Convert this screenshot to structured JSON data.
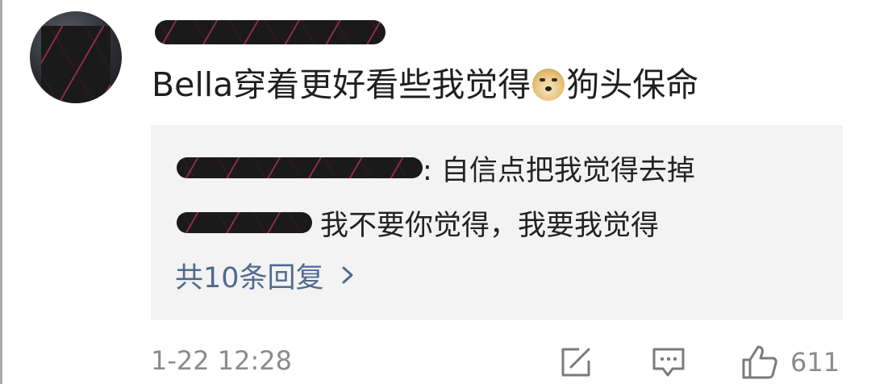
{
  "comment": {
    "text_before_emoji": "Bella穿着更好看些我觉得",
    "emoji_icon": "doge-emoji-icon",
    "text_after_emoji": "狗头保命",
    "timestamp": "1-22 12:28",
    "like_count": "611"
  },
  "replies": [
    {
      "text": ": 自信点把我觉得去掉"
    },
    {
      "text": "我不要你觉得，我要我觉得"
    }
  ],
  "view_more_label": "共10条回复",
  "icons": {
    "share": "share-icon",
    "comment": "comment-icon",
    "like": "thumbs-up-icon",
    "chevron": "chevron-right-icon"
  },
  "colors": {
    "link": "#4f6b90",
    "meta": "#8b8b8b",
    "reply_bg": "#f3f3f3"
  }
}
